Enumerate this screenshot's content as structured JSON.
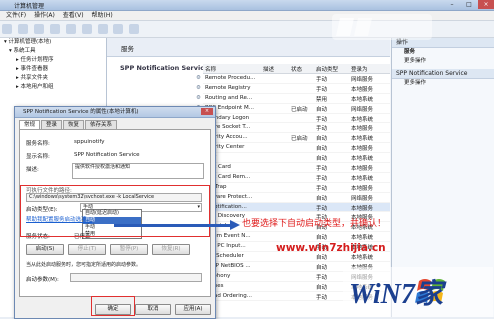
{
  "window": {
    "title": "计算机管理"
  },
  "tree": {
    "items": [
      {
        "label": "计算机管理(本地)",
        "indent": 0
      },
      {
        "label": "系统工具",
        "indent": 1
      },
      {
        "label": "任务计划程序",
        "indent": 2
      },
      {
        "label": "事件查看器",
        "indent": 2
      },
      {
        "label": "共享文件夹",
        "indent": 2
      },
      {
        "label": "本地用户和组",
        "indent": 2
      }
    ]
  },
  "services_panel": {
    "header": "服务",
    "selected_service": "SPP Notification Service",
    "columns": [
      "名称",
      "描述",
      "状态",
      "启动类型",
      "登录为"
    ],
    "rows": [
      {
        "name": "Remote Procedu...",
        "desc": "",
        "status": "",
        "startup": "手动",
        "logon": "网络服务"
      },
      {
        "name": "Remote Registry",
        "desc": "",
        "status": "",
        "startup": "手动",
        "logon": "本地服务"
      },
      {
        "name": "Routing and Re...",
        "desc": "",
        "status": "",
        "startup": "禁用",
        "logon": "本地系统"
      },
      {
        "name": "RPC Endpoint M...",
        "desc": "",
        "status": "已启动",
        "startup": "自动",
        "logon": "网络服务"
      },
      {
        "name": "econdary Logon",
        "desc": "",
        "status": "",
        "startup": "手动",
        "logon": "本地系统"
      },
      {
        "name": "ecure Socket T...",
        "desc": "",
        "status": "",
        "startup": "手动",
        "logon": "本地服务"
      },
      {
        "name": "ecurity Accou...",
        "desc": "",
        "status": "已启动",
        "startup": "自动",
        "logon": "本地系统"
      },
      {
        "name": "ecurity Center",
        "desc": "",
        "status": "",
        "startup": "自动",
        "logon": "本地服务"
      },
      {
        "name": "rver",
        "desc": "",
        "status": "",
        "startup": "自动",
        "logon": "本地系统"
      },
      {
        "name": "nart Card",
        "desc": "",
        "status": "",
        "startup": "手动",
        "logon": "本地服务"
      },
      {
        "name": "nart Card Rem...",
        "desc": "",
        "status": "",
        "startup": "手动",
        "logon": "本地系统"
      },
      {
        "name": "MP Trap",
        "desc": "",
        "status": "",
        "startup": "手动",
        "logon": "本地服务"
      },
      {
        "name": "oftware Protect...",
        "desc": "",
        "status": "",
        "startup": "自动",
        "logon": "网络服务"
      },
      {
        "name": "P Notification...",
        "desc": "",
        "status": "",
        "startup": "手动",
        "logon": "本地服务"
      },
      {
        "name": "SDP Discovery",
        "desc": "",
        "status": "",
        "startup": "手动",
        "logon": "本地服务"
      },
      {
        "name": "perfetch",
        "desc": "",
        "status": "",
        "startup": "自动",
        "logon": "本地系统"
      },
      {
        "name": "ystem Event N...",
        "desc": "",
        "status": "",
        "startup": "自动",
        "logon": "本地系统"
      },
      {
        "name": "blet PC Input...",
        "desc": "",
        "status": "",
        "startup": "手动",
        "logon": "本地系统"
      },
      {
        "name": "ask Scheduler",
        "desc": "",
        "status": "",
        "startup": "自动",
        "logon": "本地系统"
      },
      {
        "name": "CP/IP NetBIOS ...",
        "desc": "",
        "status": "",
        "startup": "自动",
        "logon": "本地服务"
      },
      {
        "name": "elephony",
        "desc": "",
        "status": "",
        "startup": "手动",
        "logon": "网络服务"
      },
      {
        "name": "nemes",
        "desc": "",
        "status": "",
        "startup": "自动",
        "logon": "本地系统"
      },
      {
        "name": "nread Ordering...",
        "desc": "",
        "status": "",
        "startup": "手动",
        "logon": "本地服务"
      }
    ]
  },
  "actions": {
    "section1": "操作",
    "section1_items": [
      "服务",
      "更多操作"
    ],
    "section2": "SPP Notification Service",
    "section2_items": [
      "更多操作"
    ]
  },
  "dialog": {
    "title": "SPP Notification Service 的属性(本地计算机)",
    "tabs": [
      "常规",
      "登录",
      "恢复",
      "依存关系"
    ],
    "service_name_label": "服务名称:",
    "service_name": "sppuinotify",
    "display_name_label": "显示名称:",
    "display_name": "SPP Notification Service",
    "desc_label": "描述:",
    "desc": "提供软件授权激活和通知",
    "path_label": "可执行文件的路径:",
    "path": "C:\\windows\\system32\\svchost.exe -k LocalService",
    "startup_label": "启动类型(E):",
    "startup_value": "手动",
    "startup_options": [
      "自动(延迟启动)",
      "自动",
      "手动",
      "禁用"
    ],
    "startup_selected_index": 1,
    "help_link": "帮助我配置服务启动选项。",
    "status_label": "服务状态:",
    "status_value": "已停止",
    "start_btn": "启动(S)",
    "stop_btn": "停止(T)",
    "pause_btn": "暂停(P)",
    "resume_btn": "恢复(R)",
    "params_hint": "当从此处启动服务时，您可指定所适用的启动参数。",
    "params_label": "启动参数(M):",
    "ok": "确定",
    "cancel": "取消",
    "apply": "应用(A)"
  },
  "annotation": {
    "text": "也要选择下自动启动类型，并确认！",
    "url": "www.win7zhijia.cn"
  },
  "watermark": {
    "brand": "WiN7家"
  },
  "colors": {
    "red": "#e03030",
    "blue": "#2a5bb8"
  }
}
